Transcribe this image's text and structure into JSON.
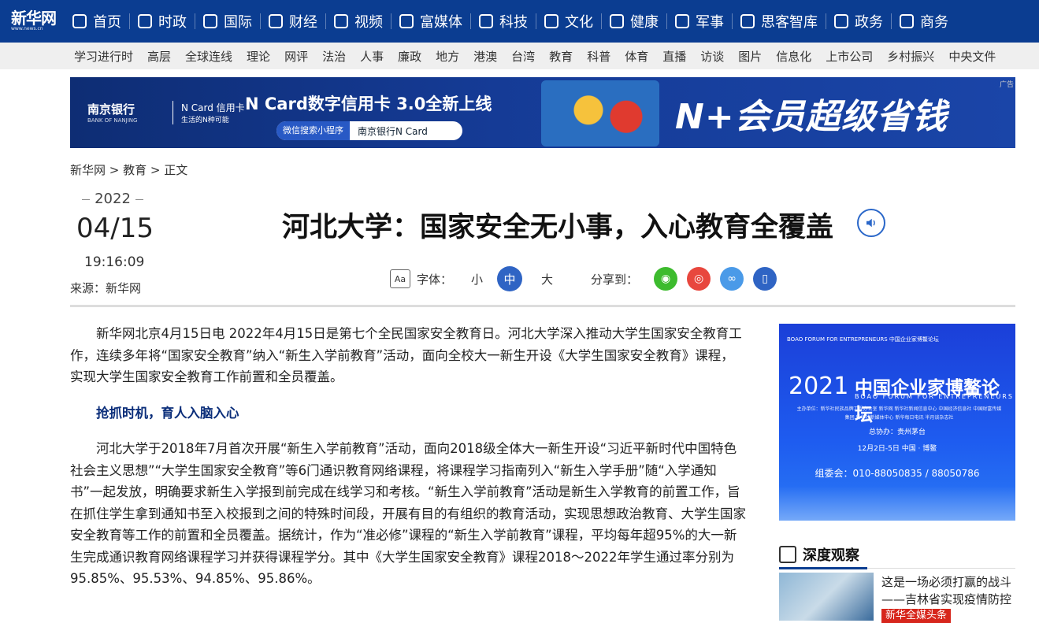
{
  "nav": {
    "logo": "新华网",
    "logo_sub": "www.news.cn",
    "items": [
      {
        "label": "首页",
        "icon": "home-icon"
      },
      {
        "label": "时政",
        "icon": "document-icon"
      },
      {
        "label": "国际",
        "icon": "globe-icon"
      },
      {
        "label": "财经",
        "icon": "chart-icon"
      },
      {
        "label": "视频",
        "icon": "play-icon"
      },
      {
        "label": "富媒体",
        "icon": "grid-icon"
      },
      {
        "label": "科技",
        "icon": "atom-icon"
      },
      {
        "label": "文化",
        "icon": "book-icon"
      },
      {
        "label": "健康",
        "icon": "heart-icon"
      },
      {
        "label": "军事",
        "icon": "shield-icon"
      },
      {
        "label": "思客智库",
        "icon": "chat-icon"
      },
      {
        "label": "政务",
        "icon": "building-icon"
      },
      {
        "label": "商务",
        "icon": "briefcase-icon"
      }
    ]
  },
  "subnav": [
    "学习进行时",
    "高层",
    "全球连线",
    "理论",
    "网评",
    "法治",
    "人事",
    "廉政",
    "地方",
    "港澳",
    "台湾",
    "教育",
    "科普",
    "体育",
    "直播",
    "访谈",
    "图片",
    "信息化",
    "上市公司",
    "乡村振兴",
    "中央文件"
  ],
  "banner": {
    "bank": "南京银行",
    "bank_en": "BANK OF NANJING",
    "ncard": "N Card 信用卡",
    "ncard_sub": "生活的N种可能",
    "headline": "N Card数字信用卡  3.0全新上线",
    "search_label": "微信搜索小程序",
    "search_text": "南京银行N Card",
    "slogan": "N+会员超级省钱",
    "ad_label": "广告"
  },
  "breadcrumb": "新华网 > 教育 > 正文",
  "date": {
    "year": "2022",
    "month_day": "04/15",
    "time": "19:16:09"
  },
  "source": "来源：新华网",
  "title": "河北大学：国家安全无小事，入心教育全覆盖",
  "toolbar": {
    "font_label": "字体：",
    "small": "小",
    "medium": "中",
    "large": "大",
    "share_label": "分享到：",
    "share_colors": {
      "wechat": "#3dbb2e",
      "weibo": "#e8473e",
      "link": "#4a9ae8",
      "mobile": "#2f64c4"
    }
  },
  "article": {
    "p1": "新华网北京4月15日电 2022年4月15日是第七个全民国家安全教育日。河北大学深入推动大学生国家安全教育工作，连续多年将“国家安全教育”纳入“新生入学前教育”活动，面向全校大一新生开设《大学生国家安全教育》课程，实现大学生国家安全教育工作前置和全员覆盖。",
    "h1": "抢抓时机，育人入脑入心",
    "p2": "河北大学于2018年7月首次开展“新生入学前教育”活动，面向2018级全体大一新生开设“习近平新时代中国特色社会主义思想”“大学生国家安全教育”等6门通识教育网络课程，将课程学习指南列入“新生入学手册”随“入学通知书”一起发放，明确要求新生入学报到前完成在线学习和考核。“新生入学前教育”活动是新生入学教育的前置工作，旨在抓住学生拿到通知书至入校报到之间的特殊时间段，开展有目的有组织的教育活动，实现思想政治教育、大学生国家安全教育等工作的前置和全员覆盖。据统计，作为“准必修”课程的“新生入学前教育”课程，平均每年超95%的大一新生完成通识教育网络课程学习并获得课程学分。其中《大学生国家安全教育》课程2018～2022年学生通过率分别为95.85%、95.53%、94.85%、95.86%。"
  },
  "side_ad": {
    "org": "BOAO FORUM FOR ENTREPRENEURS 中国企业家博鳌论坛",
    "year": "2021",
    "cname": "中国企业家博鳌论坛",
    "ename": "BOAO FORUM FOR ENTREPRENEURS",
    "host": "主办单位：新华社民族品牌工程办公室 新华网 新华社新闻信息中心 中国经济信息社 中国财富传媒集团 新华社新媒体中心 新华每日电讯 半月谈杂志社",
    "co": "总协办：贵州茅台",
    "dates": "12月2日-5日  中国 · 博鳌",
    "contact": "组委会：010-88050835 / 88050786"
  },
  "deep": {
    "title": "深度观察",
    "item_title": "这是一场必须打赢的战斗——吉林省实现疫情防控",
    "item_tag": "新华全媒头条"
  }
}
